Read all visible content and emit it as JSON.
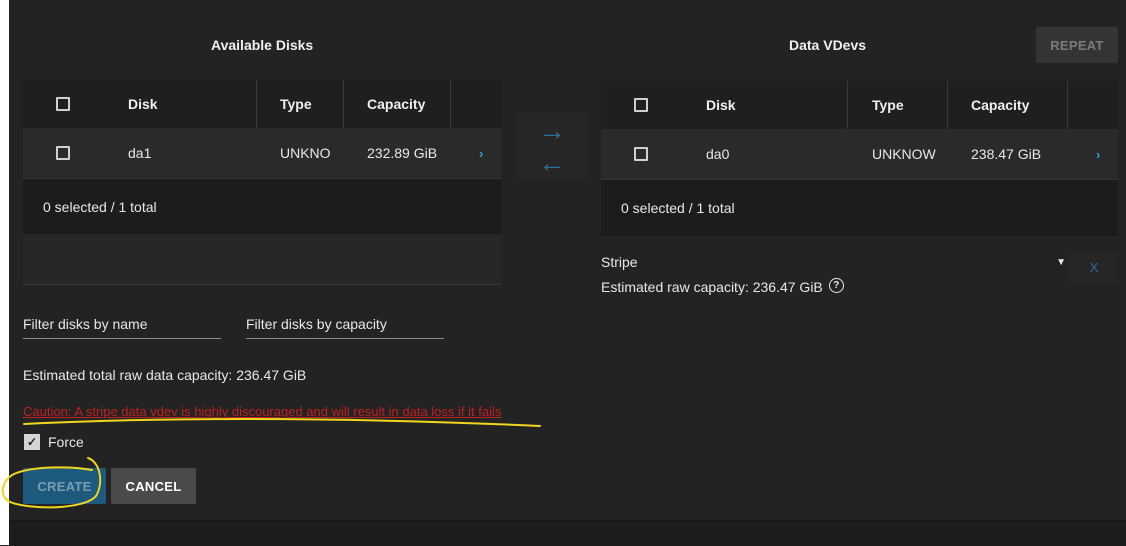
{
  "available_disks": {
    "title": "Available Disks",
    "columns": {
      "disk": "Disk",
      "type": "Type",
      "capacity": "Capacity"
    },
    "rows": [
      {
        "disk": "da1",
        "type": "UNKNO",
        "capacity": "232.89 GiB"
      }
    ],
    "footer": "0 selected / 1 total"
  },
  "data_vdevs": {
    "title": "Data VDevs",
    "repeat_label": "REPEAT",
    "columns": {
      "disk": "Disk",
      "type": "Type",
      "capacity": "Capacity"
    },
    "rows": [
      {
        "disk": "da0",
        "type": "UNKNOW",
        "capacity": "238.47 GiB"
      }
    ],
    "footer": "0 selected / 1 total",
    "layout_value": "Stripe",
    "estimated_raw": "Estimated raw capacity: 236.47 GiB",
    "remove_label": "X"
  },
  "filters": {
    "by_name_placeholder": "Filter disks by name",
    "by_capacity_placeholder": "Filter disks by capacity"
  },
  "summary": {
    "estimated_total": "Estimated total raw data capacity: 236.47 GiB",
    "caution": "Caution: A stripe data vdev is highly discouraged and will result in data loss if it fails",
    "force_label": "Force"
  },
  "actions": {
    "create": "CREATE",
    "cancel": "CANCEL"
  },
  "icons": {
    "move_right": "arrow-right-icon",
    "move_left": "arrow-left-icon",
    "expand": "chevron-right-icon",
    "help": "help-circle-icon",
    "dropdown": "caret-down-icon",
    "check": "checkmark-icon"
  },
  "colors": {
    "background": "#232323",
    "accent": "#2d6e9b",
    "caution": "#c21f1f",
    "annotation": "#f2d61e"
  }
}
